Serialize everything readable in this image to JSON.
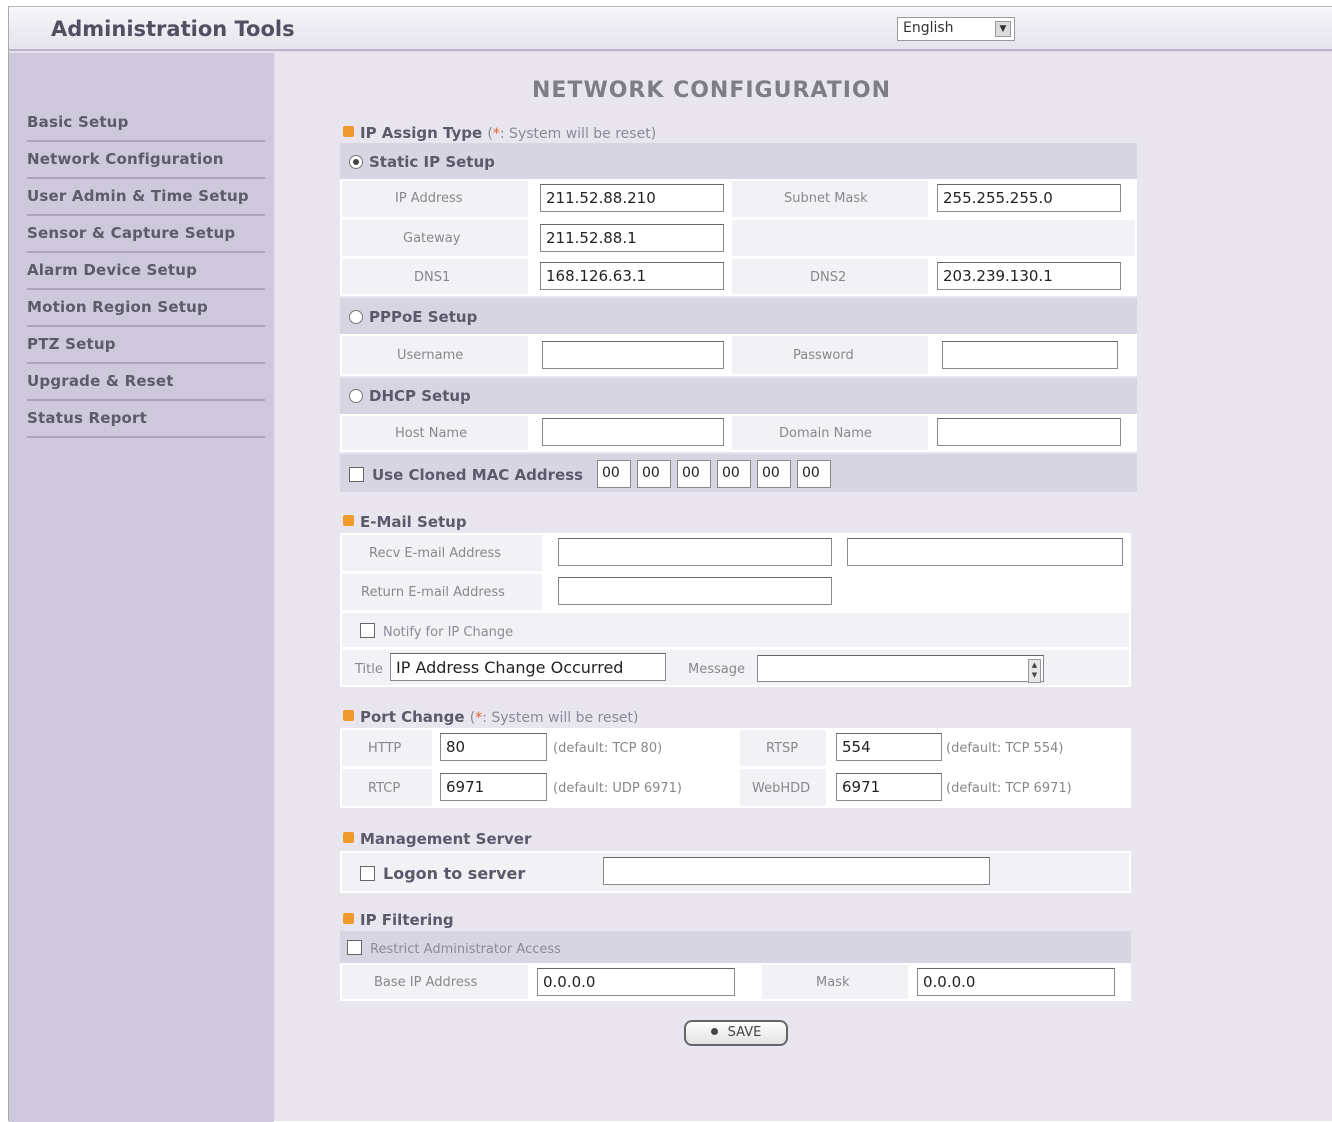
{
  "header": {
    "title": "Administration Tools",
    "language": "English"
  },
  "sidebar": {
    "items": [
      {
        "label": "Basic Setup"
      },
      {
        "label": "Network Configuration"
      },
      {
        "label": "User Admin & Time Setup"
      },
      {
        "label": "Sensor & Capture Setup"
      },
      {
        "label": "Alarm Device Setup"
      },
      {
        "label": "Motion Region Setup"
      },
      {
        "label": "PTZ Setup"
      },
      {
        "label": "Upgrade & Reset"
      },
      {
        "label": "Status Report"
      }
    ]
  },
  "main": {
    "title": "NETWORK CONFIGURATION",
    "ip_assign": {
      "heading": "IP Assign Type",
      "note_prefix": "(",
      "note_star": "*",
      "note_text": ": System will be reset)",
      "static": {
        "label": "Static IP Setup",
        "selected": true,
        "ip_label": "IP Address",
        "ip_value": "211.52.88.210",
        "subnet_label": "Subnet Mask",
        "subnet_value": "255.255.255.0",
        "gateway_label": "Gateway",
        "gateway_value": "211.52.88.1",
        "dns1_label": "DNS1",
        "dns1_value": "168.126.63.1",
        "dns2_label": "DNS2",
        "dns2_value": "203.239.130.1"
      },
      "pppoe": {
        "label": "PPPoE Setup",
        "username_label": "Username",
        "username_value": "",
        "password_label": "Password",
        "password_value": ""
      },
      "dhcp": {
        "label": "DHCP Setup",
        "host_label": "Host Name",
        "host_value": "",
        "domain_label": "Domain Name",
        "domain_value": ""
      },
      "mac": {
        "label": "Use Cloned MAC Address",
        "octets": [
          "00",
          "00",
          "00",
          "00",
          "00",
          "00"
        ]
      }
    },
    "email": {
      "heading": "E-Mail Setup",
      "recv_label": "Recv E-mail Address",
      "recv_value_1": "",
      "recv_value_2": "",
      "return_label": "Return E-mail Address",
      "return_value": "",
      "notify_label": "Notify for IP Change",
      "title_label": "Title",
      "title_value": "IP Address Change Occurred",
      "message_label": "Message",
      "message_value": ""
    },
    "port": {
      "heading": "Port Change",
      "note_prefix": "(",
      "note_star": "*",
      "note_text": ": System will be reset)",
      "http_label": "HTTP",
      "http_value": "80",
      "http_default": "(default: TCP 80)",
      "rtsp_label": "RTSP",
      "rtsp_value": "554",
      "rtsp_default": "(default: TCP 554)",
      "rtcp_label": "RTCP",
      "rtcp_value": "6971",
      "rtcp_default": "(default: UDP 6971)",
      "webhdd_label": "WebHDD",
      "webhdd_value": "6971",
      "webhdd_default": "(default: TCP 6971)"
    },
    "mgmt": {
      "heading": "Management Server",
      "logon_label": "Logon to server",
      "server_value": ""
    },
    "ipfilter": {
      "heading": "IP Filtering",
      "restrict_label": "Restrict Administrator Access",
      "base_label": "Base IP Address",
      "base_value": "0.0.0.0",
      "mask_label": "Mask",
      "mask_value": "0.0.0.0"
    },
    "save_label": "SAVE"
  },
  "colors": {
    "accent_bullet": "#f09a2c",
    "sidebar_bg": "#cdc8dc",
    "main_bg": "#e8e5ef"
  }
}
